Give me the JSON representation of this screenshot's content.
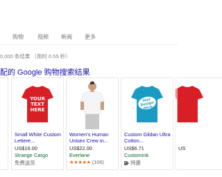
{
  "tabs": {
    "shopping": "购物",
    "videos": "视频",
    "news": "新闻",
    "more": "更多"
  },
  "results_stats": "0,000 条结果 （用时 0.55 秒）",
  "shopping_section": {
    "header": "配的 Google 购物搜索结果"
  },
  "products": [
    {
      "shirt_text": "YOUR TEXT HERE",
      "title": "Small White Custom Lettere...",
      "price": "US$16.00",
      "seller": "Strange Cargo",
      "extra": "免费送货",
      "shirt_color": "#d81f26"
    },
    {
      "title": "Women's Human Unisex Crew in...",
      "price": "US$22.00",
      "seller": "Everlane",
      "rating_stars": "★★★★★",
      "rating_count": "(106)",
      "shirt_color": "#f5f5f5"
    },
    {
      "shirt_text": "Your Design Here",
      "title": "Custom Gildan Ultra Cotton...",
      "price": "US$6.71",
      "seller": "CustomInk",
      "extra": "特惠",
      "shirt_color": "#1b9bc4"
    },
    {
      "price": "US",
      "seller": "",
      "shirt_color": "#d81f26"
    }
  ],
  "colors": {
    "link_blue": "#1a0dab",
    "seller_green": "#006621",
    "star_orange": "#e7711b",
    "muted_gray": "#777777"
  }
}
